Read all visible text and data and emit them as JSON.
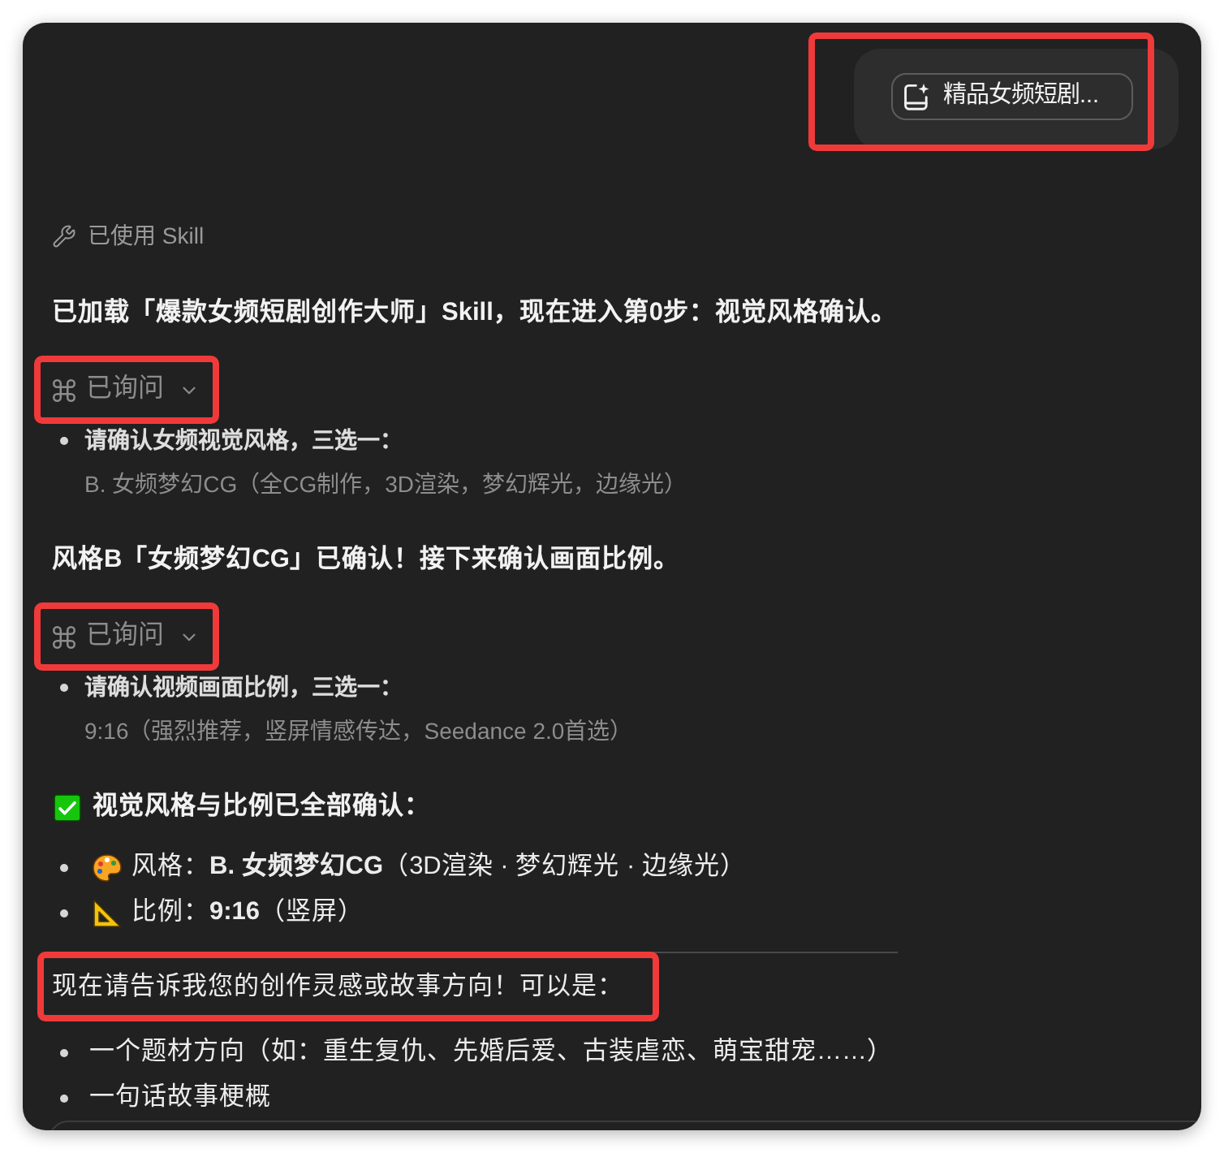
{
  "user_message": {
    "highlighted": true,
    "attachment": {
      "label": "精品女频短剧..."
    }
  },
  "transcript": [
    {
      "kind": "tool",
      "label": "已使用 Skill",
      "highlighted": false
    },
    {
      "kind": "paragraph",
      "text": "已加载「爆款女频短剧创作大师」Skill，现在进入第0步：视觉风格确认。",
      "bold": true,
      "highlighted": false
    },
    {
      "kind": "ask",
      "label": "已询问",
      "highlighted": true,
      "question": "请确认女频视觉风格，三选一：",
      "answer": "B. 女频梦幻CG（全CG制作，3D渲染，梦幻辉光，边缘光）"
    },
    {
      "kind": "paragraph",
      "text": "风格B「女频梦幻CG」已确认！接下来确认画面比例。",
      "bold": true,
      "highlighted": false
    },
    {
      "kind": "ask",
      "label": "已询问",
      "highlighted": true,
      "question": "请确认视频画面比例，三选一：",
      "answer": "9:16（强烈推荐，竖屏情感传达，Seedance 2.0首选）"
    },
    {
      "kind": "heading",
      "text": "视觉风格与比例已全部确认：",
      "highlighted": false
    },
    {
      "kind": "list",
      "with_icons": true,
      "items": [
        "风格：**B. 女频梦幻CG**（3D渲染 · 梦幻辉光 · 边缘光）",
        "比例：**9:16**（竖屏）"
      ]
    },
    {
      "kind": "rule"
    },
    {
      "kind": "paragraph",
      "text": "现在请告诉我您的创作灵感或故事方向！可以是：",
      "bold": false,
      "highlighted": true
    },
    {
      "kind": "list",
      "with_icons": false,
      "items": [
        "一个题材方向（如：重生复仇、先婚后爱、古装虐恋、萌宝甜宠……）",
        "一句话故事梗概"
      ]
    }
  ]
}
